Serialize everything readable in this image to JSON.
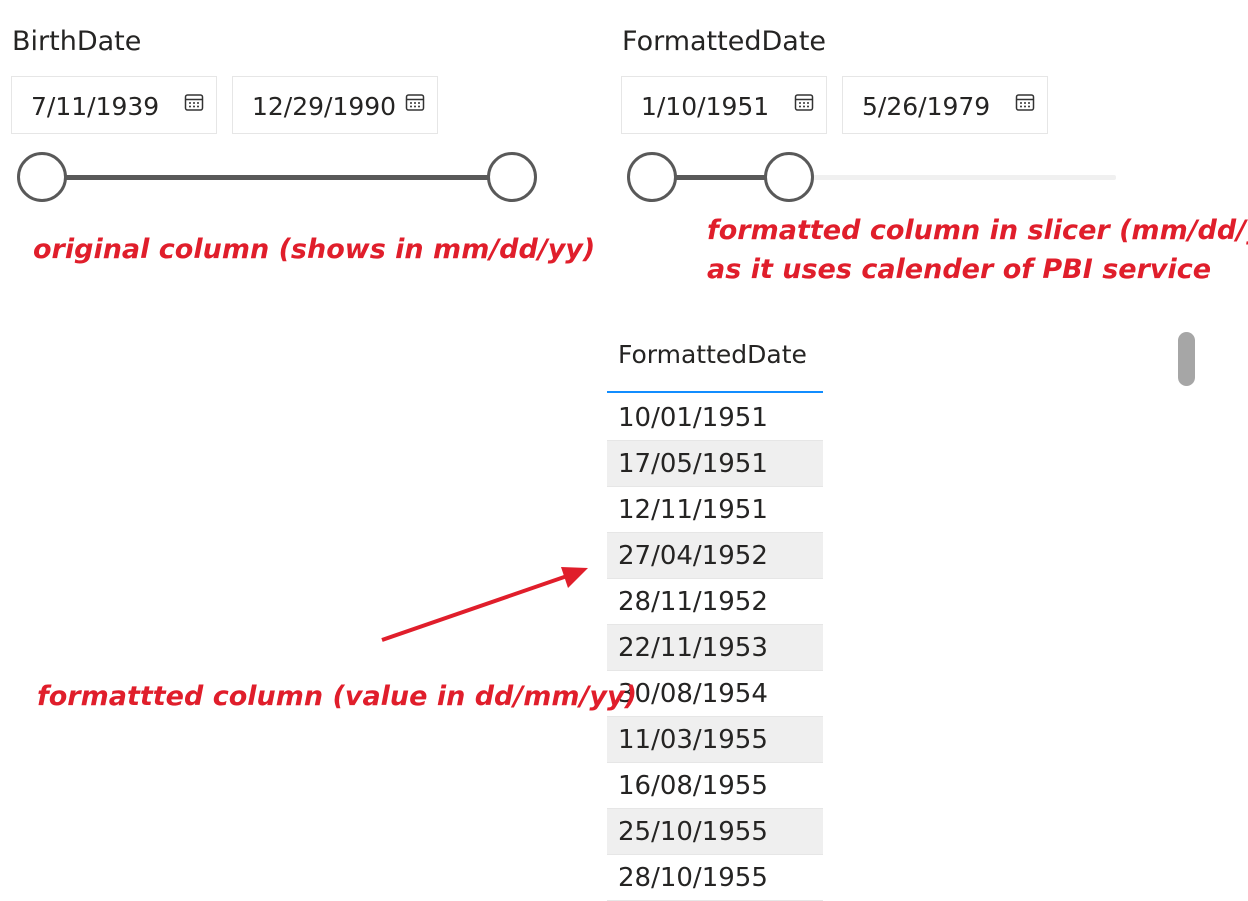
{
  "slicers": [
    {
      "title": "BirthDate",
      "start": "7/11/1939",
      "end": "12/29/1990",
      "range_fraction": [
        0,
        1
      ]
    },
    {
      "title": "FormattedDate",
      "start": "1/10/1951",
      "end": "5/26/1979",
      "range_fraction": [
        0,
        0.29
      ]
    }
  ],
  "annotations": {
    "original": "original column (shows in mm/dd/yy)",
    "slicer_line1": "formatted column in slicer (mm/dd/yy)",
    "slicer_line2": "as it uses calender of PBI service",
    "table": "formattted column (value in dd/mm/yy)"
  },
  "table": {
    "header": "FormattedDate",
    "rows": [
      "10/01/1951",
      "17/05/1951",
      "12/11/1951",
      "27/04/1952",
      "28/11/1952",
      "22/11/1953",
      "30/08/1954",
      "11/03/1955",
      "16/08/1955",
      "25/10/1955",
      "28/10/1955"
    ]
  },
  "colors": {
    "annotation": "#e01e2b",
    "header_underline": "#118dff",
    "slider": "#595959"
  },
  "icons": [
    "calendar-icon",
    "arrow-annotation"
  ]
}
